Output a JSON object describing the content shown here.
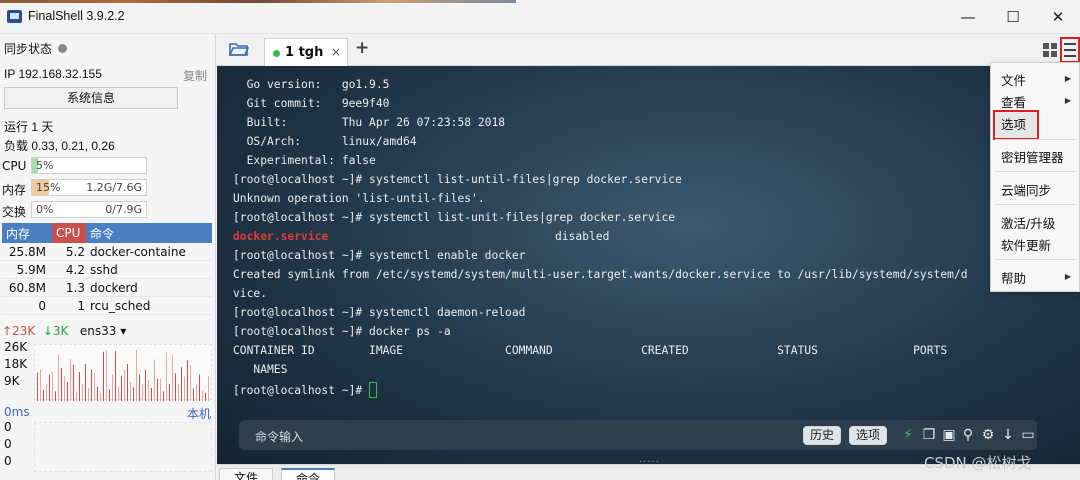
{
  "window": {
    "title": "FinalShell 3.9.2.2",
    "minimize": "—",
    "maximize": "☐",
    "close": "✕"
  },
  "sidebar": {
    "sync_label": "同步状态",
    "ip_label": "IP 192.168.32.155",
    "copy_label": "复制",
    "sysinfo_button": "系统信息",
    "uptime": "运行 1 天",
    "load": "负载 0.33, 0.21, 0.26",
    "cpu": {
      "label": "CPU",
      "pct": "5%",
      "fraction": 0.05
    },
    "mem": {
      "label": "内存",
      "pct": "15%",
      "amount": "1.2G/7.6G",
      "fraction": 0.15
    },
    "swap": {
      "label": "交换",
      "pct": "0%",
      "amount": "0/7.9G",
      "fraction": 0.0
    },
    "process_table": {
      "headers": [
        "内存",
        "CPU",
        "命令"
      ],
      "rows": [
        {
          "mem": "25.8M",
          "cpu": "5.2",
          "cmd": "docker-containe"
        },
        {
          "mem": "5.9M",
          "cpu": "4.2",
          "cmd": "sshd"
        },
        {
          "mem": "60.8M",
          "cpu": "1.3",
          "cmd": "dockerd"
        },
        {
          "mem": "0",
          "cpu": "1",
          "cmd": "rcu_sched"
        }
      ]
    },
    "network": {
      "up": "23K",
      "down": "3K",
      "interface": "ens33",
      "y_labels": [
        "26K",
        "18K",
        "9K"
      ]
    },
    "ping": {
      "label": "0ms",
      "host": "本机",
      "y_labels": [
        "0",
        "0",
        "0"
      ]
    }
  },
  "tabs": {
    "session_tab": "1 tgh",
    "close": "×",
    "add": "+"
  },
  "terminal": {
    "lines": [
      "  Go version:   go1.9.5",
      "  Git commit:   9ee9f40",
      "  Built:        Thu Apr 26 07:23:58 2018",
      "  OS/Arch:      linux/amd64",
      "  Experimental: false",
      "[root@localhost ~]# systemctl list-until-files|grep docker.service",
      "Unknown operation 'list-until-files'.",
      "[root@localhost ~]# systemctl list-unit-files|grep docker.service",
      "docker.service",
      "[root@localhost ~]# systemctl enable docker",
      "Created symlink from /etc/systemd/system/multi-user.target.wants/docker.service to /usr/lib/systemd/system/d",
      "vice.",
      "[root@localhost ~]# systemctl daemon-reload",
      "[root@localhost ~]# docker ps -a",
      "CONTAINER ID        IMAGE               COMMAND             CREATED             STATUS              PORTS",
      "   NAMES",
      "[root@localhost ~]# "
    ],
    "disabled_word": "disabled",
    "command_input_placeholder": "命令输入",
    "history_button": "历史",
    "options_button": "选项"
  },
  "bottom_tabs": [
    "文件",
    "命令"
  ],
  "watermark": "CSDN @松树戈",
  "menu": {
    "items": [
      {
        "label": "文件",
        "submenu": true
      },
      {
        "label": "查看",
        "submenu": true
      },
      {
        "label": "选项",
        "submenu": false
      },
      {
        "label": "密钥管理器",
        "submenu": false
      },
      {
        "label": "云端同步",
        "submenu": false
      },
      {
        "label": "激活/升级",
        "submenu": false
      },
      {
        "label": "软件更新",
        "submenu": false
      },
      {
        "label": "帮助",
        "submenu": true
      }
    ]
  },
  "colors": {
    "accent_blue": "#4a7fc1",
    "cpu_red": "#c9504e",
    "highlight_red": "#e02020",
    "active_green": "#2ebd4a"
  }
}
